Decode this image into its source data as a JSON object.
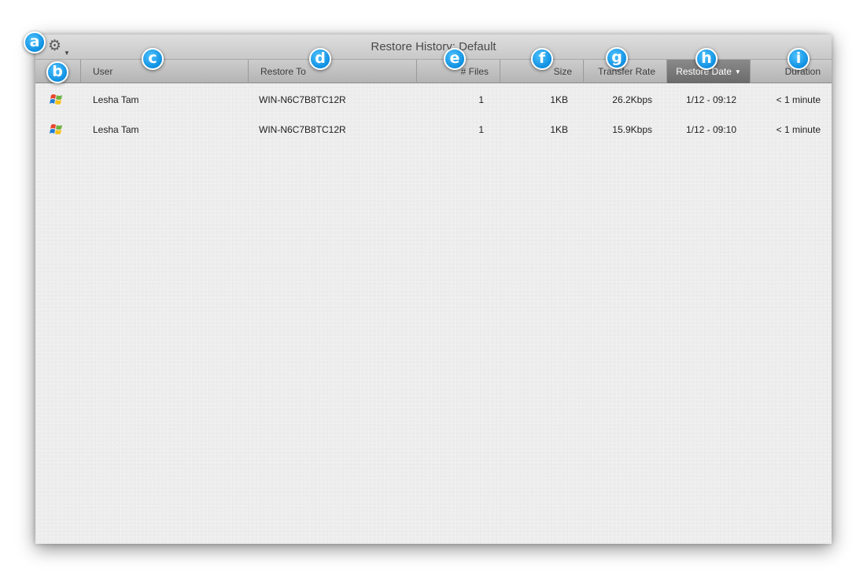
{
  "window": {
    "title": "Restore History: Default"
  },
  "toolbar": {
    "gear_icon": "gear-icon"
  },
  "columns": {
    "platform": "",
    "user": "User",
    "restore_to": "Restore To",
    "files": "# Files",
    "size": "Size",
    "transfer_rate": "Transfer Rate",
    "restore_date": "Restore Date",
    "duration": "Duration"
  },
  "sort": {
    "column": "restore_date",
    "direction": "descending"
  },
  "rows": [
    {
      "platform_icon": "windows-icon",
      "user": "Lesha Tam",
      "restore_to": "WIN-N6C7B8TC12R",
      "files": "1",
      "size": "1KB",
      "transfer_rate": "26.2Kbps",
      "restore_date": "1/12 - 09:12",
      "duration": "< 1 minute"
    },
    {
      "platform_icon": "windows-icon",
      "user": "Lesha Tam",
      "restore_to": "WIN-N6C7B8TC12R",
      "files": "1",
      "size": "1KB",
      "transfer_rate": "15.9Kbps",
      "restore_date": "1/12 - 09:10",
      "duration": "< 1 minute"
    }
  ],
  "callouts": [
    "a",
    "b",
    "c",
    "d",
    "e",
    "f",
    "g",
    "h",
    "i"
  ],
  "colors": {
    "callout": "#1a9be8",
    "selected_header": "#7a7a7a",
    "background": "#efeeef"
  }
}
